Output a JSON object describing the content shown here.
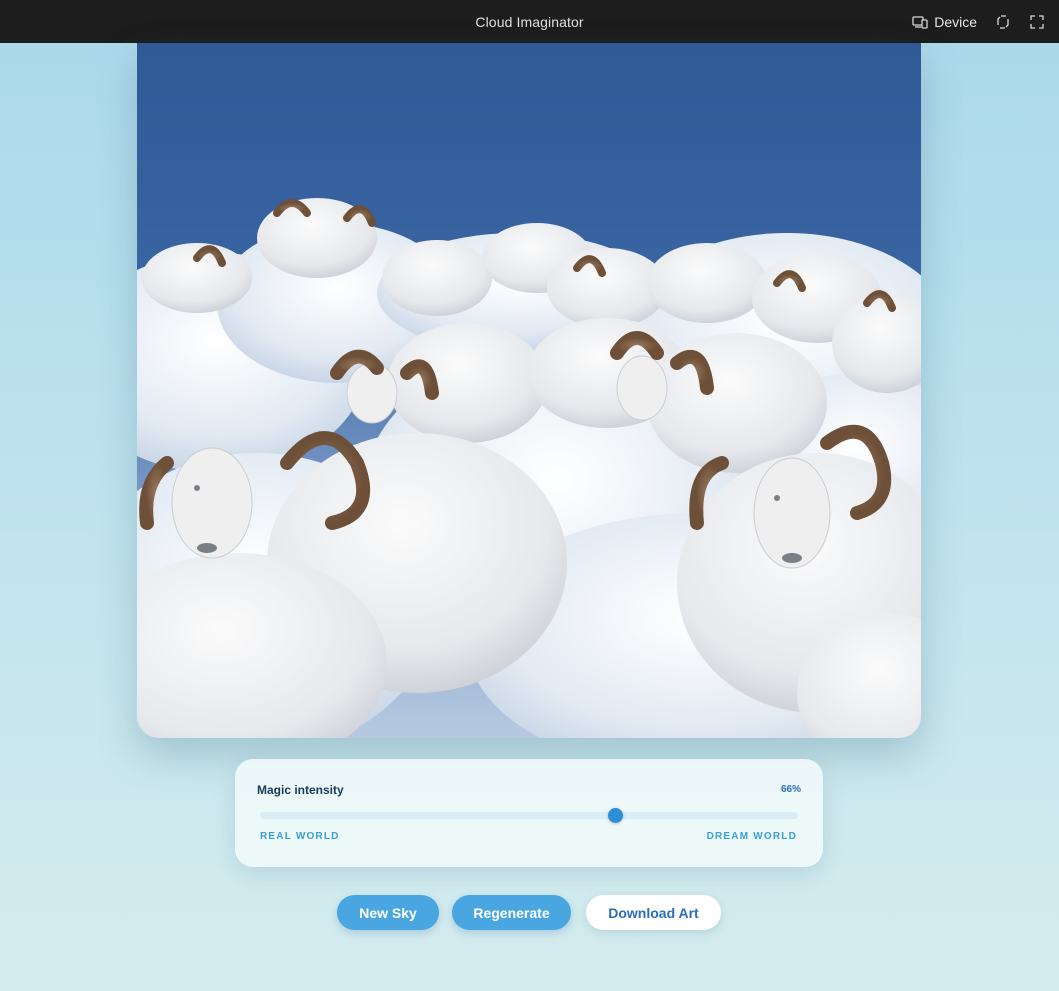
{
  "window": {
    "title": "Cloud Imaginator",
    "device_label": "Device"
  },
  "icons": {
    "device": "device-icon",
    "rotate": "rotate-icon",
    "fullscreen": "fullscreen-icon"
  },
  "artwork": {
    "subject": "rams-on-clouds-image"
  },
  "control": {
    "label": "Magic intensity",
    "value_text": "66%",
    "value": 66,
    "min_label": "REAL WORLD",
    "max_label": "DREAM WORLD"
  },
  "actions": {
    "new_sky": "New Sky",
    "regenerate": "Regenerate",
    "download": "Download Art"
  },
  "colors": {
    "accent": "#4aa6e0",
    "thumb": "#2d8ed8",
    "sky_top": "#2f5a96",
    "topbar": "#1d1d1d"
  }
}
